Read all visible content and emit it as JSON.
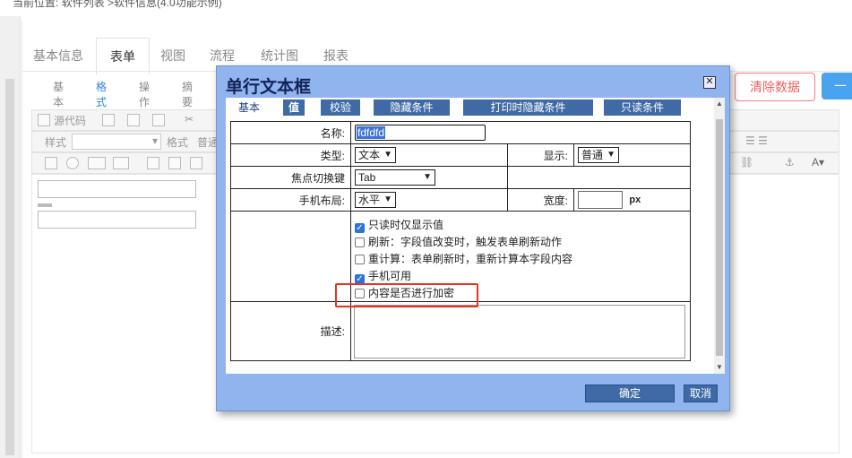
{
  "breadcrumb": {
    "prefix": "当前位置:",
    "path": "软件列表 >软件信息(4.0功能示例)"
  },
  "main_tabs": [
    {
      "label": "基本信息"
    },
    {
      "label": "表单"
    },
    {
      "label": "视图"
    },
    {
      "label": "流程"
    },
    {
      "label": "统计图"
    },
    {
      "label": "报表"
    }
  ],
  "active_main_tab": "表单",
  "sub_tabs": [
    {
      "label": "基本"
    },
    {
      "label": "格式"
    },
    {
      "label": "操作"
    },
    {
      "label": "摘要"
    }
  ],
  "active_sub_tab": "格式",
  "actions": {
    "clear_label": "清除数据",
    "blue_label": "一"
  },
  "toolbar": {
    "source_label": "源代码",
    "style_label": "样式",
    "format_label": "格式",
    "format_value": "普通"
  },
  "dialog": {
    "title": "单行文本框",
    "close_symbol": "✕",
    "tabs": [
      {
        "label": "基本"
      },
      {
        "label": "值"
      },
      {
        "label": "校验"
      },
      {
        "label": "隐藏条件"
      },
      {
        "label": "打印时隐藏条件"
      },
      {
        "label": "只读条件"
      }
    ],
    "active_tab": "基本",
    "fields": {
      "name_label": "名称:",
      "name_value": "fdfdfd",
      "type_label": "类型:",
      "type_value": "文本",
      "display_label": "显示:",
      "display_value": "普通",
      "focus_label": "焦点切换键",
      "focus_value": "Tab",
      "mobile_layout_label": "手机布局:",
      "mobile_layout_value": "水平",
      "width_label": "宽度:",
      "width_value": "",
      "width_unit": "px",
      "desc_label": "描述:",
      "desc_value": ""
    },
    "checkboxes": [
      {
        "label": "只读时仅显示值",
        "checked": true
      },
      {
        "label": "刷新：字段值改变时，触发表单刷新动作",
        "checked": false
      },
      {
        "label": "重计算：表单刷新时，重新计算本字段内容",
        "checked": false
      },
      {
        "label": "手机可用",
        "checked": true
      },
      {
        "label": "内容是否进行加密",
        "checked": false
      }
    ],
    "buttons": {
      "ok": "确定",
      "cancel": "取消"
    }
  }
}
